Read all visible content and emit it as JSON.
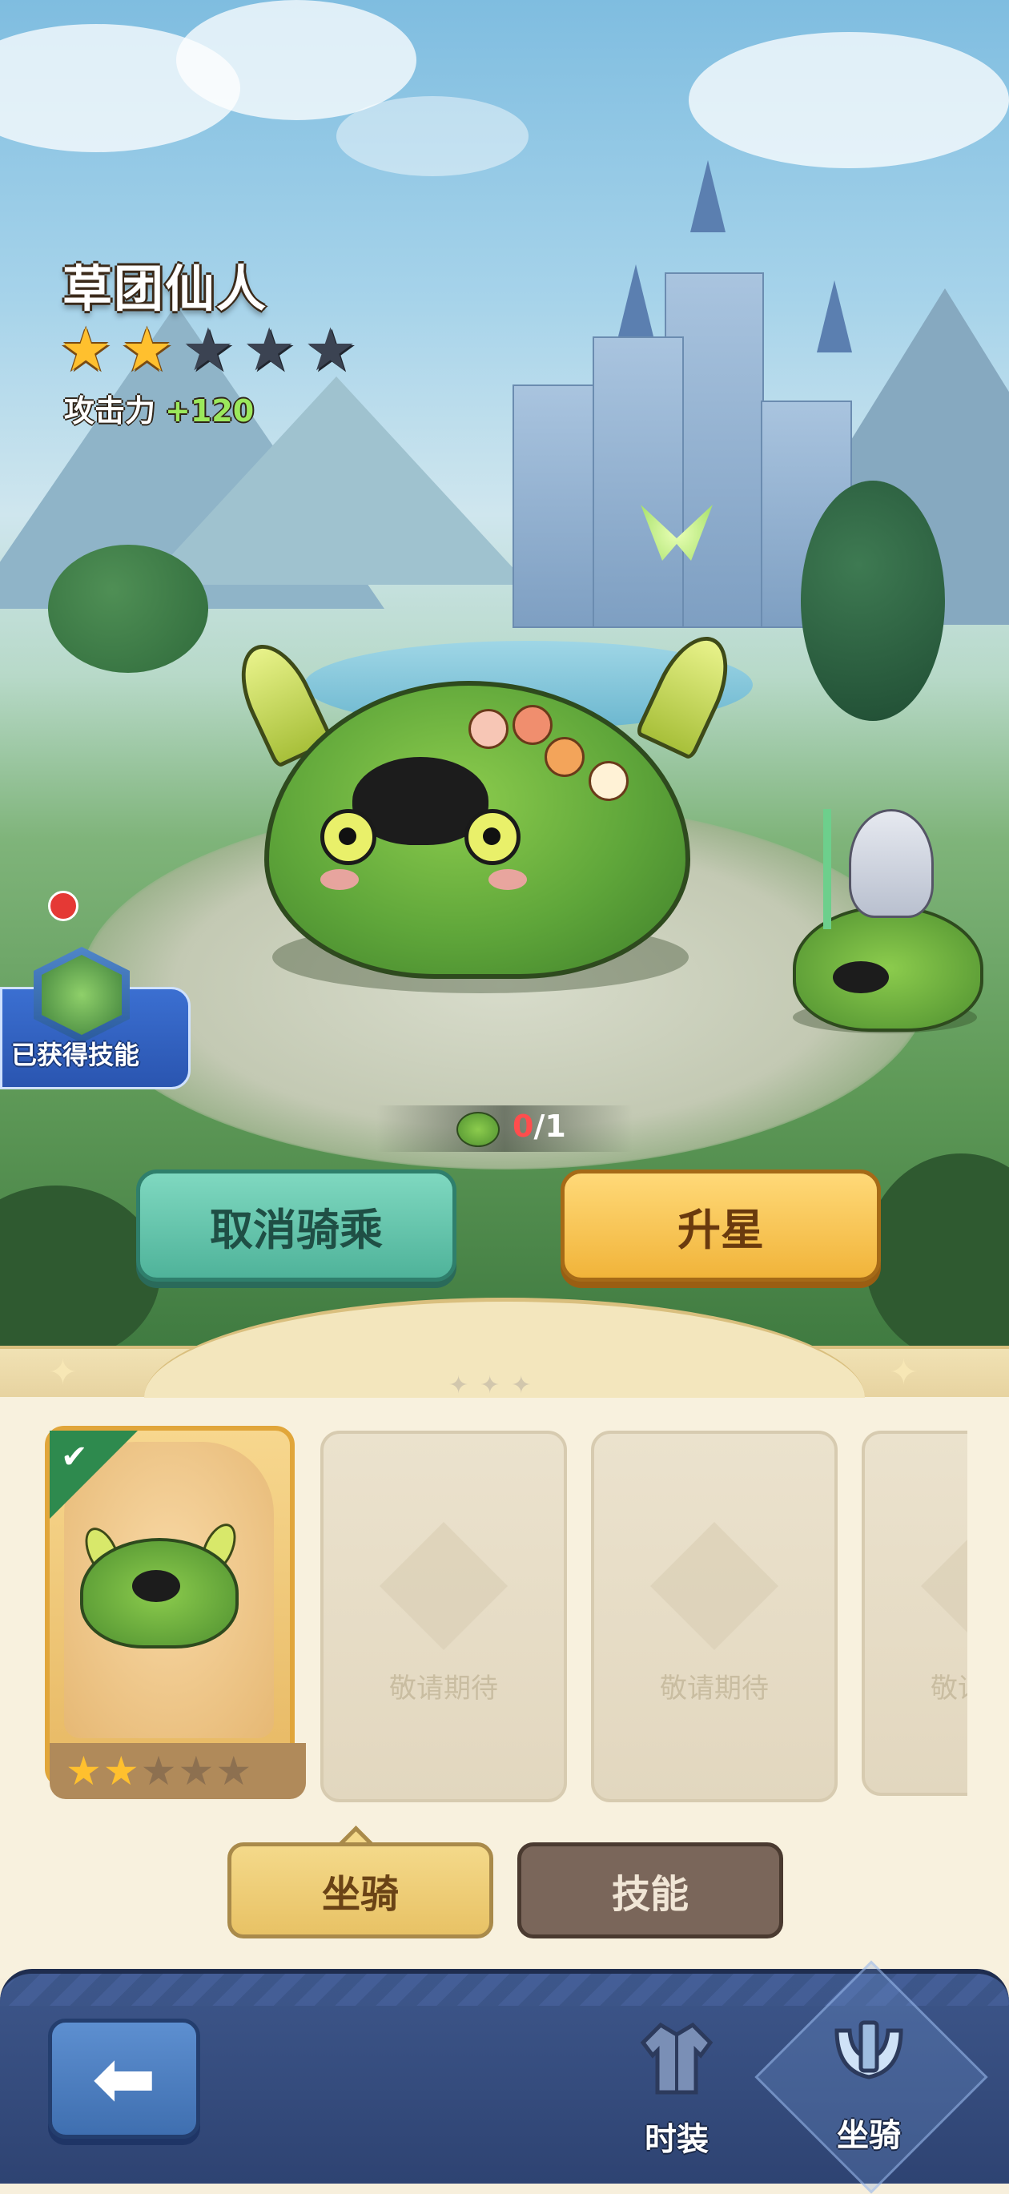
{
  "mount": {
    "name": "草团仙人",
    "stars_total": 5,
    "stars_filled": 2,
    "attack_label": "攻击力",
    "attack_value": "+120",
    "fragments_current": "0",
    "fragments_total": "/1"
  },
  "skill_badge": {
    "label": "已获得技能"
  },
  "actions": {
    "cancel_label": "取消骑乘",
    "upgrade_label": "升星"
  },
  "cards": {
    "placeholder_text": "敬请期待",
    "selected_card_stars_filled": 2,
    "selected_card_stars_total": 5
  },
  "tabs": {
    "mount_label": "坐骑",
    "skill_label": "技能",
    "selected": "mount"
  },
  "nav": {
    "back_icon": "arrow-left-icon",
    "items": [
      {
        "label": "时装",
        "icon": "outfit-icon"
      },
      {
        "label": "坐骑",
        "icon": "saddle-icon",
        "selected": true
      }
    ]
  },
  "colors": {
    "star_on": "#ffc02e",
    "star_off": "#3b4352",
    "attack_value": "#9be85c",
    "cancel_button": "#5fc4aa",
    "upgrade_button": "#f4c552",
    "nav_bg": "#34497c"
  }
}
